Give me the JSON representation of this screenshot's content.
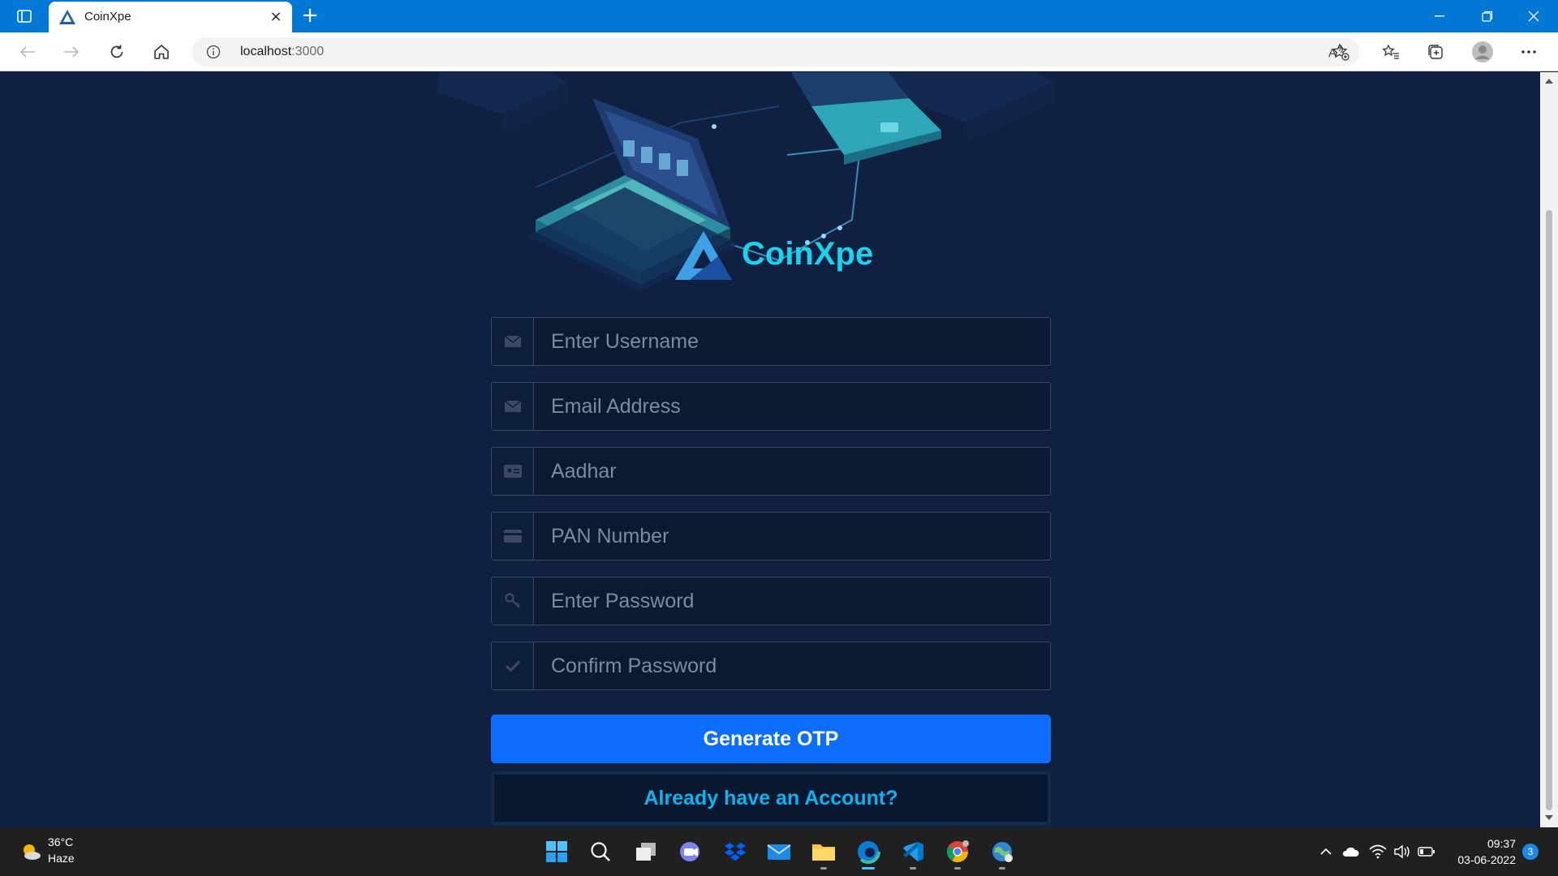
{
  "browser": {
    "tab_title": "CoinXpe",
    "new_tab_label": "+",
    "close_tab_label": "×",
    "url_host": "localhost",
    "url_port": ":3000"
  },
  "page": {
    "brand_name": "CoinXpe",
    "fields": [
      {
        "placeholder": "Enter Username",
        "icon": "envelope-icon"
      },
      {
        "placeholder": "Email Address",
        "icon": "envelope-icon"
      },
      {
        "placeholder": "Aadhar",
        "icon": "id-card-icon"
      },
      {
        "placeholder": "PAN Number",
        "icon": "credit-card-icon"
      },
      {
        "placeholder": "Enter Password",
        "icon": "key-icon"
      },
      {
        "placeholder": "Confirm Password",
        "icon": "check-icon"
      }
    ],
    "generate_otp_label": "Generate OTP",
    "account_link_label": "Already have an Account?"
  },
  "taskbar": {
    "weather_temp": "36°C",
    "weather_condition": "Haze",
    "time": "09:37",
    "date": "03-06-2022",
    "notification_count": "3"
  },
  "colors": {
    "titlebar": "#0078d4",
    "page_bg": "#0f2041",
    "brand": "#18d4f0",
    "primary_button": "#0d6efd",
    "link_text": "#0ab4f0"
  }
}
